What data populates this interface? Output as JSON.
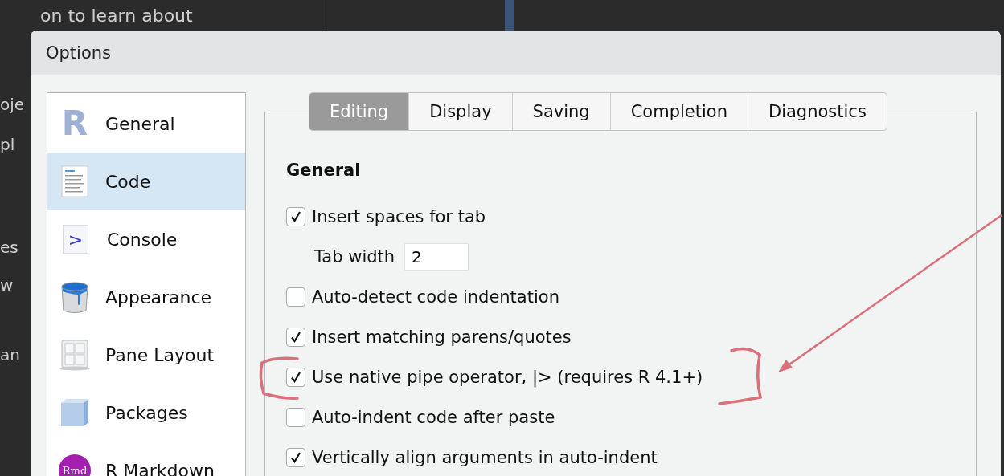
{
  "background_text": {
    "top": "on to learn about",
    "fragments": [
      "oje",
      "pl",
      "es",
      "w",
      "an"
    ]
  },
  "window": {
    "title": "Options"
  },
  "sidebar": {
    "items": [
      {
        "label": "General",
        "kind": "r-logo",
        "icon_text": "R",
        "selected": false
      },
      {
        "label": "Code",
        "kind": "document",
        "selected": true
      },
      {
        "label": "Console",
        "kind": "prompt",
        "icon_text": ">",
        "selected": false
      },
      {
        "label": "Appearance",
        "kind": "paint-bucket",
        "selected": false
      },
      {
        "label": "Pane Layout",
        "kind": "grid",
        "selected": false
      },
      {
        "label": "Packages",
        "kind": "cube",
        "selected": false
      },
      {
        "label": "R Markdown",
        "kind": "rmd-badge",
        "icon_text": "Rmd",
        "selected": false
      }
    ]
  },
  "tabs": [
    {
      "label": "Editing",
      "selected": true
    },
    {
      "label": "Display",
      "selected": false
    },
    {
      "label": "Saving",
      "selected": false
    },
    {
      "label": "Completion",
      "selected": false
    },
    {
      "label": "Diagnostics",
      "selected": false
    }
  ],
  "section": {
    "heading": "General"
  },
  "options": [
    {
      "kind": "checkbox",
      "label": "Insert spaces for tab",
      "checked": true
    },
    {
      "kind": "number",
      "label": "Tab width",
      "value": "2"
    },
    {
      "kind": "checkbox",
      "label": "Auto-detect code indentation",
      "checked": false
    },
    {
      "kind": "checkbox",
      "label": "Insert matching parens/quotes",
      "checked": true
    },
    {
      "kind": "checkbox",
      "label": "Use native pipe operator, |> (requires R 4.1+)",
      "checked": true
    },
    {
      "kind": "checkbox",
      "label": "Auto-indent code after paste",
      "checked": false
    },
    {
      "kind": "checkbox",
      "label": "Vertically align arguments in auto-indent",
      "checked": true
    }
  ]
}
